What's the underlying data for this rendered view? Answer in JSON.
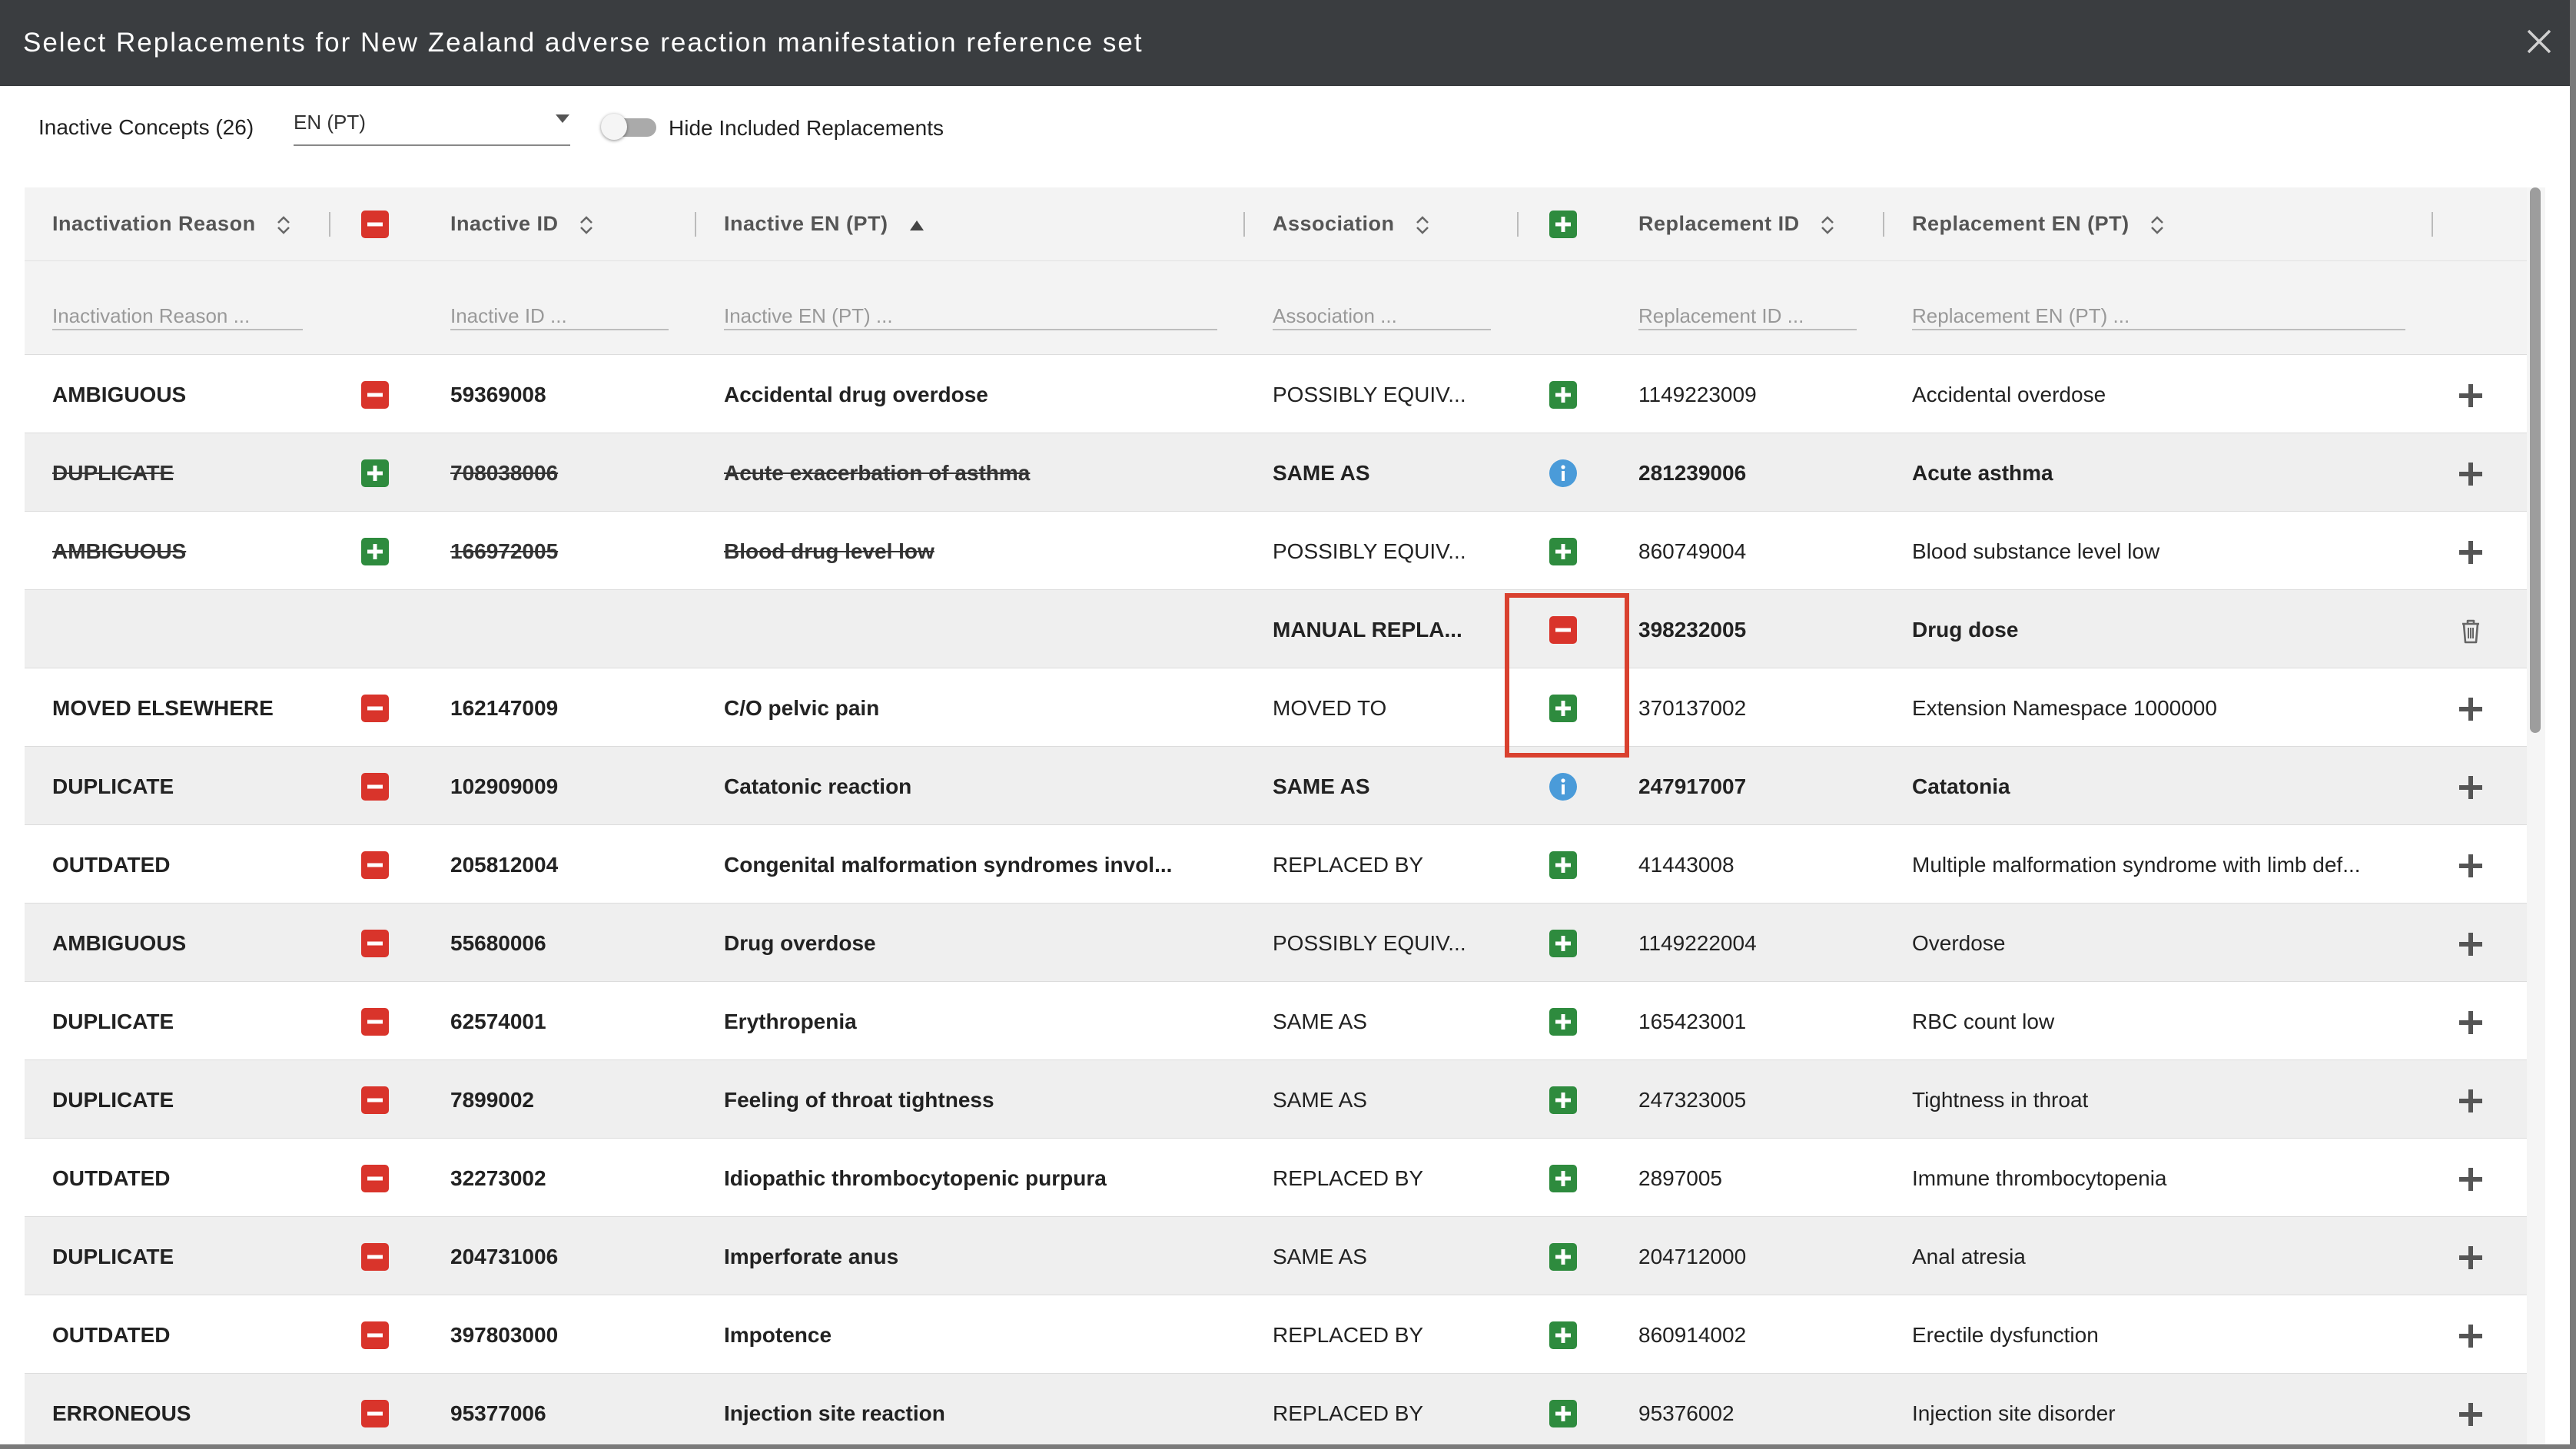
{
  "dialog": {
    "title": "Select Replacements for New Zealand adverse reaction manifestation reference set",
    "close_icon": "close-icon"
  },
  "toolbar": {
    "inactive_label": "Inactive Concepts (26)",
    "language_value": "EN (PT)",
    "toggle_label": "Hide Included Replacements",
    "toggle_on": false
  },
  "columns": {
    "inactivation_reason": "Inactivation Reason",
    "inactive_id": "Inactive ID",
    "inactive_en": "Inactive EN (PT)",
    "association": "Association",
    "replacement_id": "Replacement ID",
    "replacement_en": "Replacement EN (PT)"
  },
  "filters": {
    "inactivation_reason": "Inactivation Reason ...",
    "inactive_id": "Inactive ID ...",
    "inactive_en": "Inactive EN (PT) ...",
    "association": "Association ...",
    "replacement_id": "Replacement ID ...",
    "replacement_en": "Replacement EN (PT) ..."
  },
  "colors": {
    "remove_red": "#d9342b",
    "add_green": "#2e8b3e",
    "info_blue": "#4a9bd9",
    "highlight_red": "#d9412f"
  },
  "rows": [
    {
      "reason": "AMBIGUOUS",
      "inactive_id": "59369008",
      "inactive_en": "Accidental drug overdose",
      "association": "POSSIBLY EQUIV...",
      "replacement_id": "1149223009",
      "replacement_en": "Accidental overdose",
      "left_icon": "remove",
      "mid_icon": "add",
      "action_icon": "plus",
      "struck": false,
      "bold_replacement": false,
      "bold_association": false
    },
    {
      "reason": "DUPLICATE",
      "inactive_id": "708038006",
      "inactive_en": "Acute exacerbation of asthma",
      "association": "SAME AS",
      "replacement_id": "281239006",
      "replacement_en": "Acute asthma",
      "left_icon": "add",
      "mid_icon": "info",
      "action_icon": "plus",
      "struck": true,
      "bold_replacement": true,
      "bold_association": true
    },
    {
      "reason": "AMBIGUOUS",
      "inactive_id": "166972005",
      "inactive_en": "Blood drug level low",
      "association": "POSSIBLY EQUIV...",
      "replacement_id": "860749004",
      "replacement_en": "Blood substance level low",
      "left_icon": "add",
      "mid_icon": "add",
      "action_icon": "plus",
      "struck": true,
      "bold_replacement": false,
      "bold_association": false
    },
    {
      "reason": "",
      "inactive_id": "",
      "inactive_en": "",
      "association": "MANUAL REPLA...",
      "replacement_id": "398232005",
      "replacement_en": "Drug dose",
      "left_icon": "none",
      "mid_icon": "remove",
      "action_icon": "trash",
      "struck": false,
      "bold_replacement": true,
      "bold_association": true
    },
    {
      "reason": "MOVED ELSEWHERE",
      "inactive_id": "162147009",
      "inactive_en": "C/O pelvic pain",
      "association": "MOVED TO",
      "replacement_id": "370137002",
      "replacement_en": "Extension Namespace 1000000",
      "left_icon": "remove",
      "mid_icon": "add",
      "action_icon": "plus",
      "struck": false,
      "bold_replacement": false,
      "bold_association": false
    },
    {
      "reason": "DUPLICATE",
      "inactive_id": "102909009",
      "inactive_en": "Catatonic reaction",
      "association": "SAME AS",
      "replacement_id": "247917007",
      "replacement_en": "Catatonia",
      "left_icon": "remove",
      "mid_icon": "info",
      "action_icon": "plus",
      "struck": false,
      "bold_replacement": true,
      "bold_association": true
    },
    {
      "reason": "OUTDATED",
      "inactive_id": "205812004",
      "inactive_en": "Congenital malformation syndromes invol...",
      "association": "REPLACED BY",
      "replacement_id": "41443008",
      "replacement_en": "Multiple malformation syndrome with limb def...",
      "left_icon": "remove",
      "mid_icon": "add",
      "action_icon": "plus",
      "struck": false,
      "bold_replacement": false,
      "bold_association": false
    },
    {
      "reason": "AMBIGUOUS",
      "inactive_id": "55680006",
      "inactive_en": "Drug overdose",
      "association": "POSSIBLY EQUIV...",
      "replacement_id": "1149222004",
      "replacement_en": "Overdose",
      "left_icon": "remove",
      "mid_icon": "add",
      "action_icon": "plus",
      "struck": false,
      "bold_replacement": false,
      "bold_association": false
    },
    {
      "reason": "DUPLICATE",
      "inactive_id": "62574001",
      "inactive_en": "Erythropenia",
      "association": "SAME AS",
      "replacement_id": "165423001",
      "replacement_en": "RBC count low",
      "left_icon": "remove",
      "mid_icon": "add",
      "action_icon": "plus",
      "struck": false,
      "bold_replacement": false,
      "bold_association": false
    },
    {
      "reason": "DUPLICATE",
      "inactive_id": "7899002",
      "inactive_en": "Feeling of throat tightness",
      "association": "SAME AS",
      "replacement_id": "247323005",
      "replacement_en": "Tightness in throat",
      "left_icon": "remove",
      "mid_icon": "add",
      "action_icon": "plus",
      "struck": false,
      "bold_replacement": false,
      "bold_association": false
    },
    {
      "reason": "OUTDATED",
      "inactive_id": "32273002",
      "inactive_en": "Idiopathic thrombocytopenic purpura",
      "association": "REPLACED BY",
      "replacement_id": "2897005",
      "replacement_en": "Immune thrombocytopenia",
      "left_icon": "remove",
      "mid_icon": "add",
      "action_icon": "plus",
      "struck": false,
      "bold_replacement": false,
      "bold_association": false
    },
    {
      "reason": "DUPLICATE",
      "inactive_id": "204731006",
      "inactive_en": "Imperforate anus",
      "association": "SAME AS",
      "replacement_id": "204712000",
      "replacement_en": "Anal atresia",
      "left_icon": "remove",
      "mid_icon": "add",
      "action_icon": "plus",
      "struck": false,
      "bold_replacement": false,
      "bold_association": false
    },
    {
      "reason": "OUTDATED",
      "inactive_id": "397803000",
      "inactive_en": "Impotence",
      "association": "REPLACED BY",
      "replacement_id": "860914002",
      "replacement_en": "Erectile dysfunction",
      "left_icon": "remove",
      "mid_icon": "add",
      "action_icon": "plus",
      "struck": false,
      "bold_replacement": false,
      "bold_association": false
    },
    {
      "reason": "ERRONEOUS",
      "inactive_id": "95377006",
      "inactive_en": "Injection site reaction",
      "association": "REPLACED BY",
      "replacement_id": "95376002",
      "replacement_en": "Injection site disorder",
      "left_icon": "remove",
      "mid_icon": "add",
      "action_icon": "plus",
      "struck": false,
      "bold_replacement": false,
      "bold_association": false
    }
  ]
}
